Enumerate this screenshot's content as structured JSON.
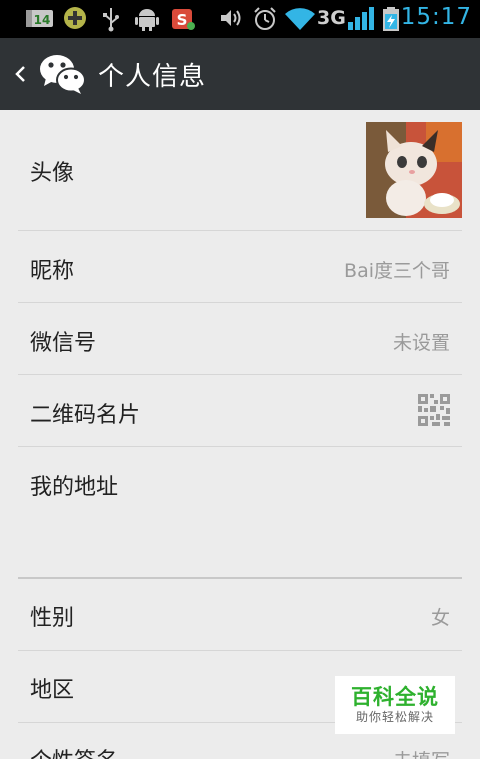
{
  "status_bar": {
    "time": "15:17",
    "network": "3G",
    "notification_badge": "14",
    "icons": [
      "badge-icon",
      "game-icon",
      "usb-icon",
      "android-icon",
      "app-icon",
      "volume-icon",
      "alarm-icon",
      "wifi-icon",
      "signal-icon",
      "battery-icon"
    ]
  },
  "header": {
    "title": "个人信息",
    "back_icon": "chevron-left-icon",
    "logo_icon": "wechat-icon"
  },
  "rows": [
    {
      "label": "头像",
      "value": "",
      "kind": "avatar"
    },
    {
      "label": "昵称",
      "value": "Bai度三个哥"
    },
    {
      "label": "微信号",
      "value": "未设置"
    },
    {
      "label": "二维码名片",
      "value": "",
      "kind": "qr-icon"
    },
    {
      "label": "我的地址",
      "value": ""
    },
    {
      "label": "性别",
      "value": "女"
    },
    {
      "label": "地区",
      "value": ""
    },
    {
      "label": "个性签名",
      "value": "未填写"
    }
  ],
  "watermark": {
    "title": "百科全说",
    "subtitle": "助你轻松解决"
  },
  "colors": {
    "actionbar": "#2f3336",
    "background": "#ececec",
    "status_accent": "#33b5e5",
    "watermark_green": "#2eb12e"
  }
}
